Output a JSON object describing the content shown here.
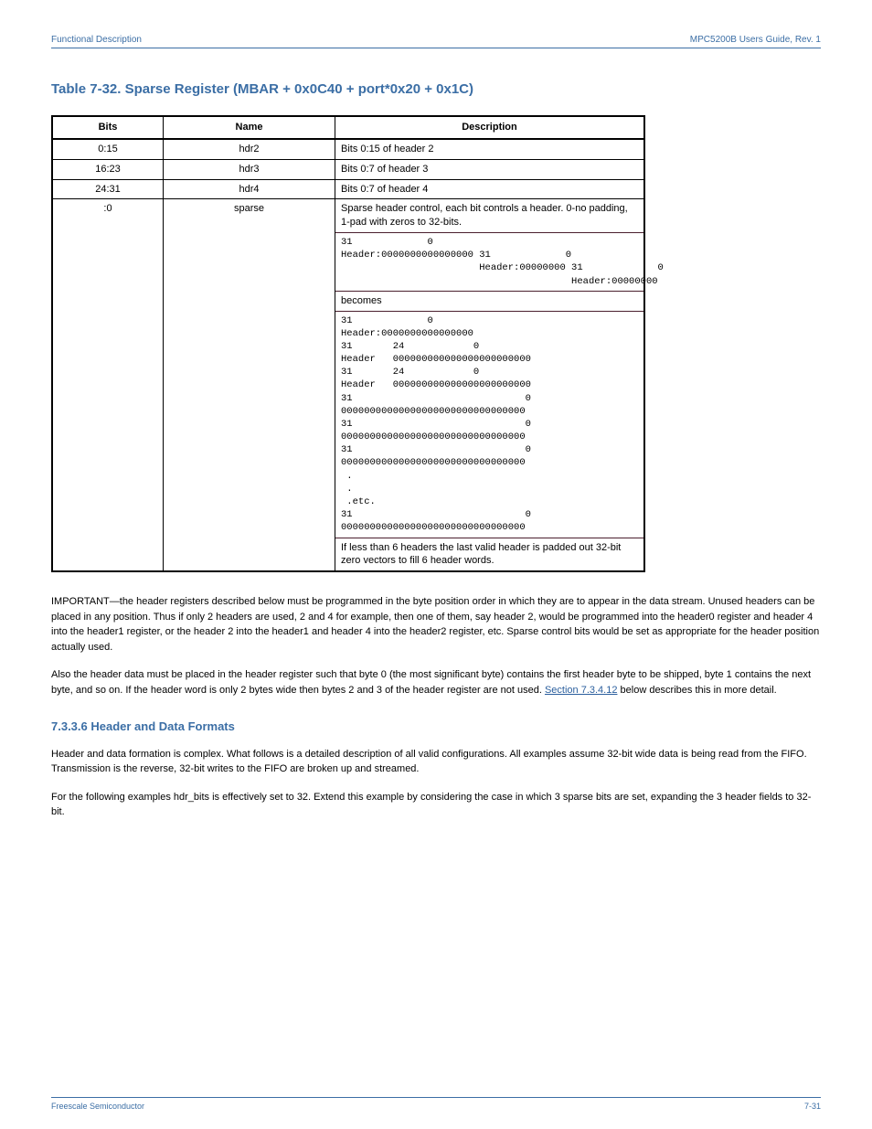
{
  "header": {
    "left": "Functional Description",
    "right": "MPC5200B Users Guide, Rev. 1"
  },
  "section_title": "Table 7-32. Sparse Register (MBAR + 0x0C40 + port*0x20 + 0x1C)",
  "table": {
    "headers": [
      "Bits",
      "Name",
      "Description"
    ],
    "rows": [
      {
        "bits": "0:15",
        "name": "hdr2",
        "desc_plain": "Bits 0:15 of header 2"
      },
      {
        "bits": "16:23",
        "name": "hdr3",
        "desc_plain": "Bits 0:7 of header 3"
      },
      {
        "bits": "24:31",
        "name": "hdr4",
        "desc_plain": "Bits 0:7 of header 4"
      }
    ],
    "sparse_prefix": ":0",
    "sparse_desc_intro": "Sparse header control, each bit controls a header. 0-no padding, 1-pad with zeros to 32-bits.",
    "sparse_block1": "31             0\nHeader:0000000000000000 31             0\n                        Header:00000000 31             0\n                                        Header:00000000",
    "sparse_mid": "becomes",
    "sparse_block2": "31             0\nHeader:0000000000000000\n31       24            0\nHeader   000000000000000000000000\n31       24            0\nHeader   000000000000000000000000\n31                              0\n00000000000000000000000000000000\n31                              0\n00000000000000000000000000000000\n31                              0\n00000000000000000000000000000000\n .\n .\n .etc.\n31                              0\n00000000000000000000000000000000",
    "sparse_trailer": "If less than 6 headers the last valid header is padded out 32-bit zero vectors to fill 6 header words."
  },
  "para1": "IMPORTANT—the header registers described below must be programmed in the byte position order in which they are to appear in the data stream. Unused headers can be placed in any position. Thus if only 2 headers are used, 2 and 4 for example, then one of them, say header 2, would be programmed into the header0 register and header 4 into the header1 register, or the header 2 into the header1 and header 4 into the header2 register, etc. Sparse control bits would be set as appropriate for the header position actually used.",
  "para2_a": "Also the header data must be placed in the header register such that byte 0 (the most significant byte) contains the first header byte to be shipped, byte 1 contains the next byte, and so on. If the header word is only 2 bytes wide then bytes 2 and 3 of the header register are not used. ",
  "xref_text": "Section 7.3.4.12",
  "para2_b": " below describes this in more detail.",
  "subsection_title": "7.3.3.6   Header and Data Formats",
  "para3": "Header and data formation is complex. What follows is a detailed description of all valid configurations. All examples assume 32-bit wide data is being read from the FIFO. Transmission is the reverse, 32-bit writes to the FIFO are broken up and streamed.",
  "para4": "For the following examples hdr_bits is effectively set to 32. Extend this example by considering the case in which 3 sparse bits are set, expanding the 3 header fields to 32-bit.",
  "footer": {
    "left": "Freescale Semiconductor",
    "right": "7-31"
  }
}
